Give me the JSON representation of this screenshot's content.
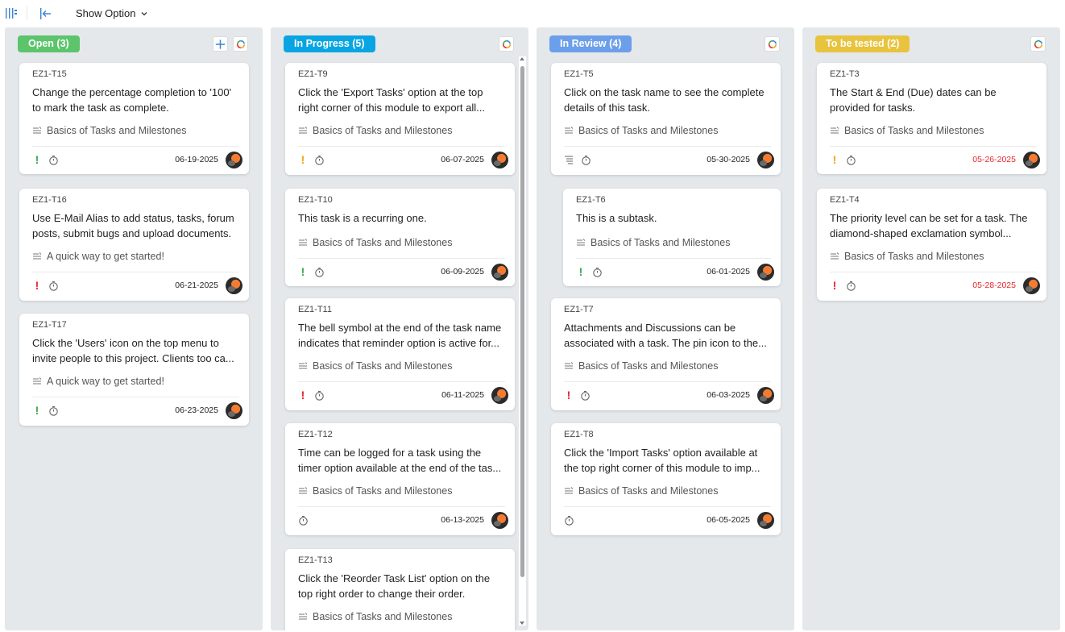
{
  "toolbar": {
    "show_option": "Show Option",
    "icons": [
      "columns-icon",
      "collapse-left-icon",
      "chevron-down-icon"
    ]
  },
  "colors": {
    "open": "#5cc46b",
    "in_progress": "#08a5e2",
    "in_review": "#6c9fea",
    "to_be_tested": "#e8c33e",
    "column_bg": "#e4e8eb",
    "priority_green": "#3ea650",
    "priority_orange": "#f2a412",
    "priority_red": "#e8262b",
    "overdue_date": "#e8262b"
  },
  "columns": [
    {
      "label": "Open (3)",
      "cards": [
        {
          "id": "EZ1-T15",
          "title": "Change the percentage completion to '100' to mark the task as complete.",
          "milestone": "Basics of Tasks and Milestones",
          "priority": "green",
          "date": "06-19-2025"
        },
        {
          "id": "EZ1-T16",
          "title": "Use E-Mail Alias to add status, tasks, forum posts, submit bugs and upload documents.",
          "milestone": "A quick way to get started!",
          "priority": "red",
          "date": "06-21-2025"
        },
        {
          "id": "EZ1-T17",
          "title": "Click the 'Users' icon on the top menu to invite people to this project. Clients too ca...",
          "milestone": "A quick way to get started!",
          "priority": "green",
          "date": "06-23-2025"
        }
      ]
    },
    {
      "label": "In Progress (5)",
      "cards": [
        {
          "id": "EZ1-T9",
          "title": "Click the 'Export Tasks' option at the top right corner of this module to export all...",
          "milestone": "Basics of Tasks and Milestones",
          "priority": "orange",
          "date": "06-07-2025"
        },
        {
          "id": "EZ1-T10",
          "title": "This task is a recurring one.",
          "milestone": "Basics of Tasks and Milestones",
          "priority": "green",
          "date": "06-09-2025"
        },
        {
          "id": "EZ1-T11",
          "title": "The bell symbol at the end of the task name indicates that reminder option is active for...",
          "milestone": "Basics of Tasks and Milestones",
          "priority": "red",
          "date": "06-11-2025"
        },
        {
          "id": "EZ1-T12",
          "title": "Time can be logged for a task using the timer option available at the end of the tas...",
          "milestone": "Basics of Tasks and Milestones",
          "priority": "none",
          "date": "06-13-2025"
        },
        {
          "id": "EZ1-T13",
          "title": "Click the 'Reorder Task List' option on the top right order to change their order.",
          "milestone": "Basics of Tasks and Milestones",
          "priority": "none",
          "date": ""
        }
      ]
    },
    {
      "label": "In Review (4)",
      "cards": [
        {
          "id": "EZ1-T5",
          "title": "Click on the task name to see the complete details of this task.",
          "milestone": "Basics of Tasks and Milestones",
          "priority": "subtasks",
          "date": "05-30-2025"
        },
        {
          "id": "EZ1-T6",
          "title": "This is a subtask.",
          "milestone": "Basics of Tasks and Milestones",
          "priority": "green",
          "date": "06-01-2025"
        },
        {
          "id": "EZ1-T7",
          "title": "Attachments and Discussions can be associated with a task. The pin icon to the...",
          "milestone": "Basics of Tasks and Milestones",
          "priority": "red",
          "date": "06-03-2025"
        },
        {
          "id": "EZ1-T8",
          "title": "Click the 'Import Tasks' option available at the top right corner of this module to imp...",
          "milestone": "Basics of Tasks and Milestones",
          "priority": "none",
          "date": "06-05-2025"
        }
      ]
    },
    {
      "label": "To be tested (2)",
      "cards": [
        {
          "id": "EZ1-T3",
          "title": "The Start & End (Due) dates can be provided for tasks.",
          "milestone": "Basics of Tasks and Milestones",
          "priority": "orange",
          "date": "05-26-2025",
          "overdue": true
        },
        {
          "id": "EZ1-T4",
          "title": "The priority level can be set for a task. The diamond-shaped exclamation symbol...",
          "milestone": "Basics of Tasks and Milestones",
          "priority": "red",
          "date": "05-28-2025",
          "overdue": true
        }
      ]
    }
  ]
}
